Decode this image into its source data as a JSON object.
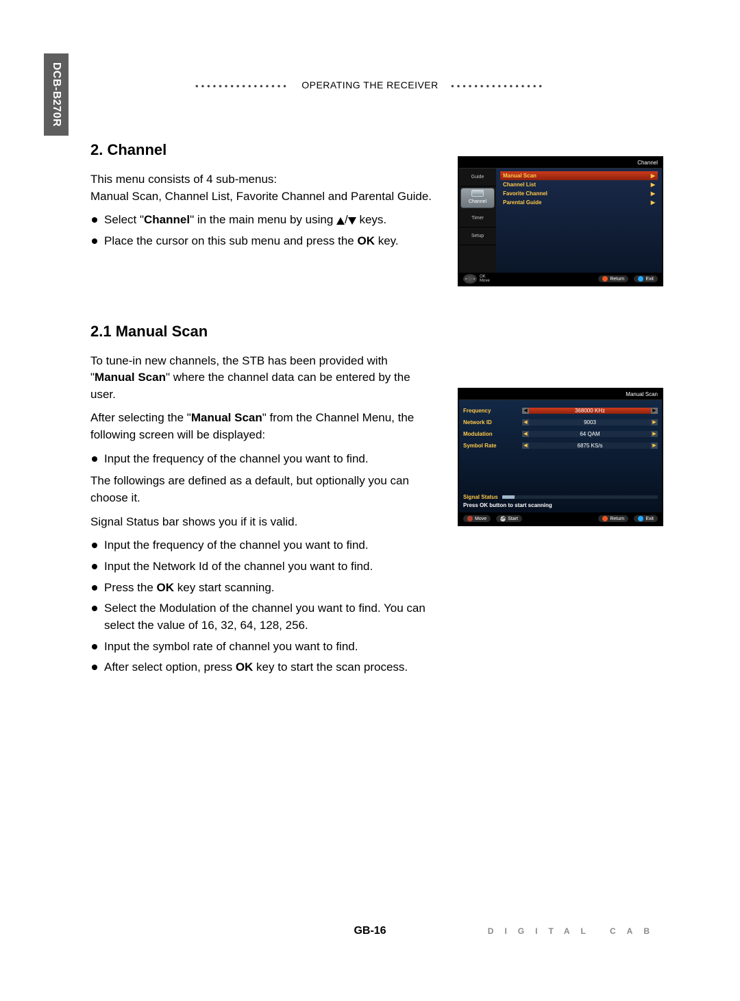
{
  "model": "DCB-B270R",
  "header": "OPERATING THE RECEIVER",
  "section2": {
    "title": "2. Channel",
    "intro1": "This menu consists of 4 sub-menus:",
    "intro2": "Manual Scan, Channel List, Favorite Channel and Parental Guide.",
    "b1_pre": "Select \"",
    "b1_bold": "Channel",
    "b1_post": "\" in the main menu by using ",
    "b1_tail": " keys.",
    "b2_pre": "Place the cursor on this sub menu and press the ",
    "b2_bold": "OK",
    "b2_post": " key."
  },
  "section21": {
    "title": "2.1 Manual Scan",
    "p1_pre": "To tune-in new channels, the STB has been provided with \"",
    "p1_bold": "Manual Scan",
    "p1_post": "\" where the channel data can be entered by the user.",
    "p2_pre": "After selecting the \"",
    "p2_bold": "Manual Scan",
    "p2_post": "\" from the Channel Menu, the following screen will be displayed:",
    "b1": "Input the frequency of the channel you want to find.",
    "p3": "The followings are defined as a default, but optionally you can choose it.",
    "p4": "Signal Status bar shows you if it is valid.",
    "b2": "Input the frequency of the channel you want to find.",
    "b3": "Input the Network Id of the channel you want to find.",
    "b4_pre": "Press the ",
    "b4_bold": "OK",
    "b4_post": " key start scanning.",
    "b5": "Select the Modulation of the channel you want to find. You can select the value of 16, 32, 64, 128, 256.",
    "b6": "Input the symbol rate of channel you want to find.",
    "b7_pre": "After select option, press ",
    "b7_bold": "OK",
    "b7_post": " key to start the scan process."
  },
  "shot1": {
    "title": "Channel",
    "tabs": [
      "Guide",
      "Channel",
      "Timer",
      "Setup"
    ],
    "items": [
      "Manual Scan",
      "Channel List",
      "Favorite Channel",
      "Parental Guide"
    ],
    "foot": {
      "ok": "OK",
      "move": "Move",
      "return": "Return",
      "exit": "Exit"
    }
  },
  "shot2": {
    "title": "Manual Scan",
    "rows": [
      {
        "label": "Frequency",
        "value": "368000 KHz"
      },
      {
        "label": "Network ID",
        "value": "9003"
      },
      {
        "label": "Modulation",
        "value": "64 QAM"
      },
      {
        "label": "Symbol Rate",
        "value": "6875 KS/s"
      }
    ],
    "signal": "Signal Status",
    "hint": "Press OK button to start scanning",
    "foot": {
      "move": "Move",
      "start": "Start",
      "return": "Return",
      "exit": "Exit"
    }
  },
  "footer": {
    "page": "GB-16",
    "brand": "DIGITAL CAB"
  }
}
